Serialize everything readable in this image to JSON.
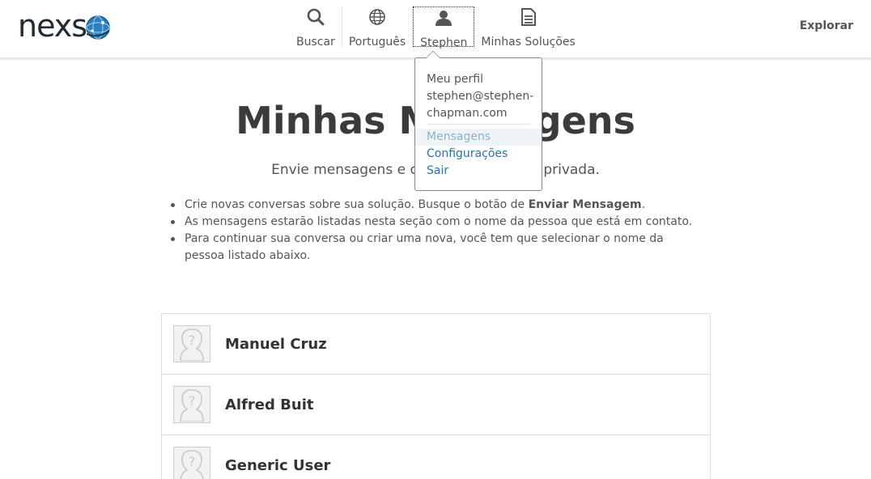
{
  "header": {
    "logo_text": "nexs",
    "nav": [
      {
        "label": "Buscar",
        "icon": "search-icon"
      },
      {
        "label": "Português",
        "icon": "globe-icon"
      },
      {
        "label": "Stephen",
        "icon": "user-icon"
      },
      {
        "label": "Minhas Soluções",
        "icon": "document-icon"
      }
    ],
    "explore": "Explorar"
  },
  "dropdown": {
    "profile_label": "Meu perfil",
    "email_line1": "stephen@stephen-",
    "email_line2": "chapman.com",
    "links": [
      "Mensagens",
      "Configurações",
      "Sair"
    ]
  },
  "main": {
    "title": "Minhas Mensagens",
    "subtitle": "Envie mensagens e converse de forma privada.",
    "bullets": {
      "b1_prefix": "Crie novas conversas sobre sua solução. Busque o botão de ",
      "b1_bold": "Enviar Mensagem",
      "b1_suffix": ".",
      "b2": "As mensagens estarão listadas nesta seção com o nome da pessoa que está em contato.",
      "b3": "Para continuar sua conversa ou criar uma nova, você tem que selecionar o nome da pessoa listado abaixo."
    },
    "contacts": [
      "Manuel Cruz",
      "Alfred Buit",
      "Generic User"
    ]
  },
  "colors": {
    "link": "#2a73a8",
    "link_highlight": "#8fb0cc",
    "globe_blue": "#2e7fc0"
  }
}
